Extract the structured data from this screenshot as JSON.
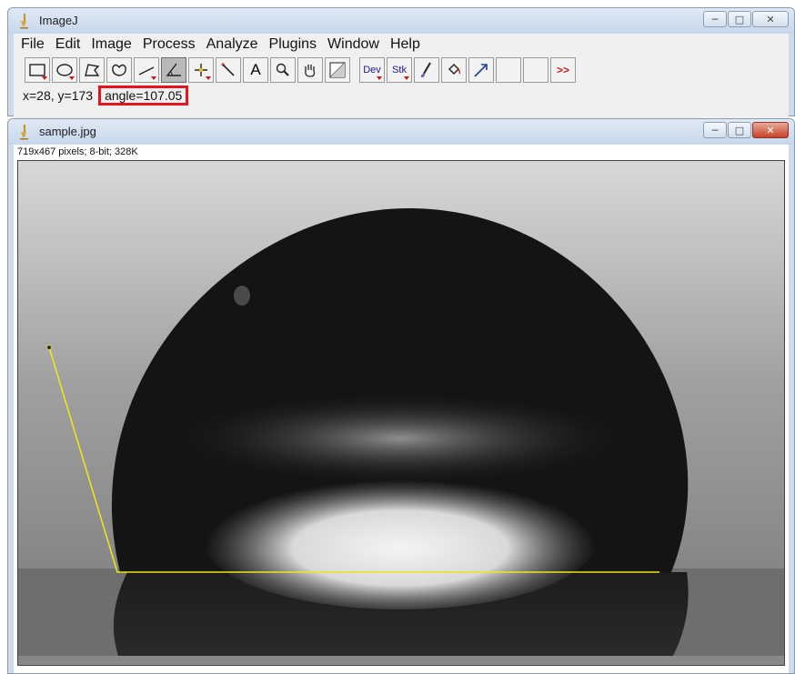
{
  "main_window": {
    "title": "ImageJ",
    "menu": [
      "File",
      "Edit",
      "Image",
      "Process",
      "Analyze",
      "Plugins",
      "Window",
      "Help"
    ],
    "toolbar": {
      "text_tool_label": "A",
      "dev_label": "Dev",
      "stk_label": "Stk",
      "more_label": ">>"
    },
    "status": {
      "coords": "x=28, y=173",
      "angle": "angle=107.05"
    },
    "accent_color": "#e2141c"
  },
  "image_window": {
    "title": "sample.jpg",
    "info": "719x467 pixels; 8-bit; 328K",
    "overlay_color": "#f2e21a"
  }
}
